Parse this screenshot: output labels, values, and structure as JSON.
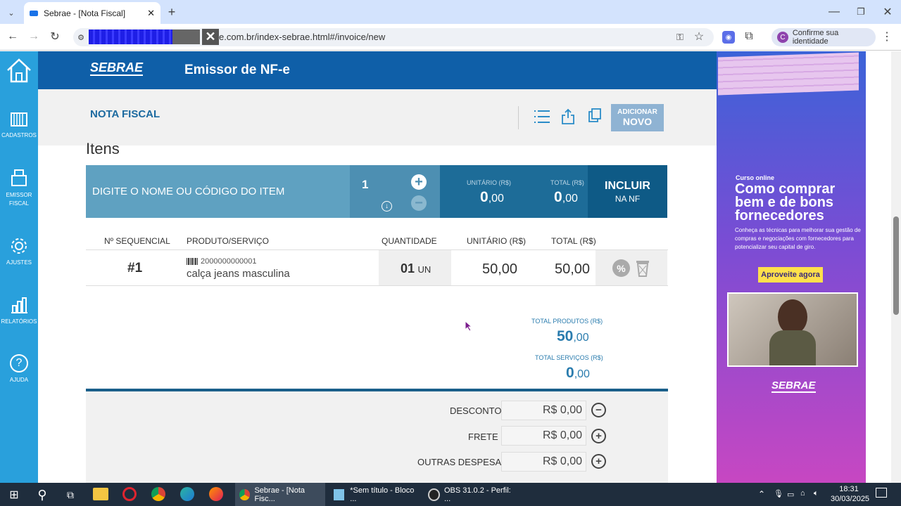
{
  "browser": {
    "tab_title": "Sebrae - [Nota Fiscal]",
    "url_suffix": "e.com.br/index-sebrae.html#/invoice/new",
    "profile_label": "Confirme sua identidade"
  },
  "sidebar": {
    "items": [
      {
        "label": "CADASTROS"
      },
      {
        "label": "EMISSOR FISCAL"
      },
      {
        "label": "AJUSTES"
      },
      {
        "label": "RELATÓRIOS"
      },
      {
        "label": "AJUDA"
      }
    ]
  },
  "header": {
    "logo": "SEBRAE",
    "title": "Emissor de NF-e"
  },
  "subheader": {
    "title": "NOTA FISCAL",
    "add_small": "ADICIONAR",
    "add_big": "NOVO"
  },
  "items_section": {
    "heading": "Itens",
    "search_placeholder": "DIGITE O NOME OU CÓDIGO DO ITEM",
    "qty": "1",
    "unit_label": "UNITÁRIO (R$)",
    "unit_int": "0",
    "unit_dec": ",00",
    "total_label": "TOTAL (R$)",
    "total_int": "0",
    "total_dec": ",00",
    "include_main": "INCLUIR",
    "include_sub": "NA NF"
  },
  "table": {
    "headers": [
      "Nº SEQUENCIAL",
      "PRODUTO/SERVIÇO",
      "QUANTIDADE",
      "UNITÁRIO (R$)",
      "TOTAL (R$)"
    ],
    "rows": [
      {
        "seq": "#1",
        "code": "2000000000001",
        "name": "calça jeans masculina",
        "qty": "01",
        "unit": "UN",
        "unit_price": "50,00",
        "total": "50,00"
      }
    ]
  },
  "totals": {
    "products_label": "TOTAL PRODUTOS (R$)",
    "products_int": "50",
    "products_dec": ",00",
    "services_label": "TOTAL SERVIÇOS (R$)",
    "services_int": "0",
    "services_dec": ",00"
  },
  "adjustments": [
    {
      "label": "DESCONTO",
      "value": "R$ 0,00",
      "sign": "−"
    },
    {
      "label": "FRETE",
      "value": "R$ 0,00",
      "sign": "+"
    },
    {
      "label": "OUTRAS DESPESAS",
      "value": "R$ 0,00",
      "sign": "+"
    }
  ],
  "ad": {
    "tag": "Curso online",
    "headline": "Como comprar bem e de bons fornecedores",
    "body": "Conheça as técnicas para melhorar sua gestão de compras e negociações com fornecedores para potencializar seu capital de giro.",
    "cta": "Aproveite agora",
    "logo": "SEBRAE"
  },
  "taskbar": {
    "items": [
      "Sebrae - [Nota Fisc...",
      "*Sem título - Bloco ...",
      "OBS 31.0.2 - Perfil: ..."
    ],
    "time": "18:31",
    "date": "30/03/2025"
  }
}
